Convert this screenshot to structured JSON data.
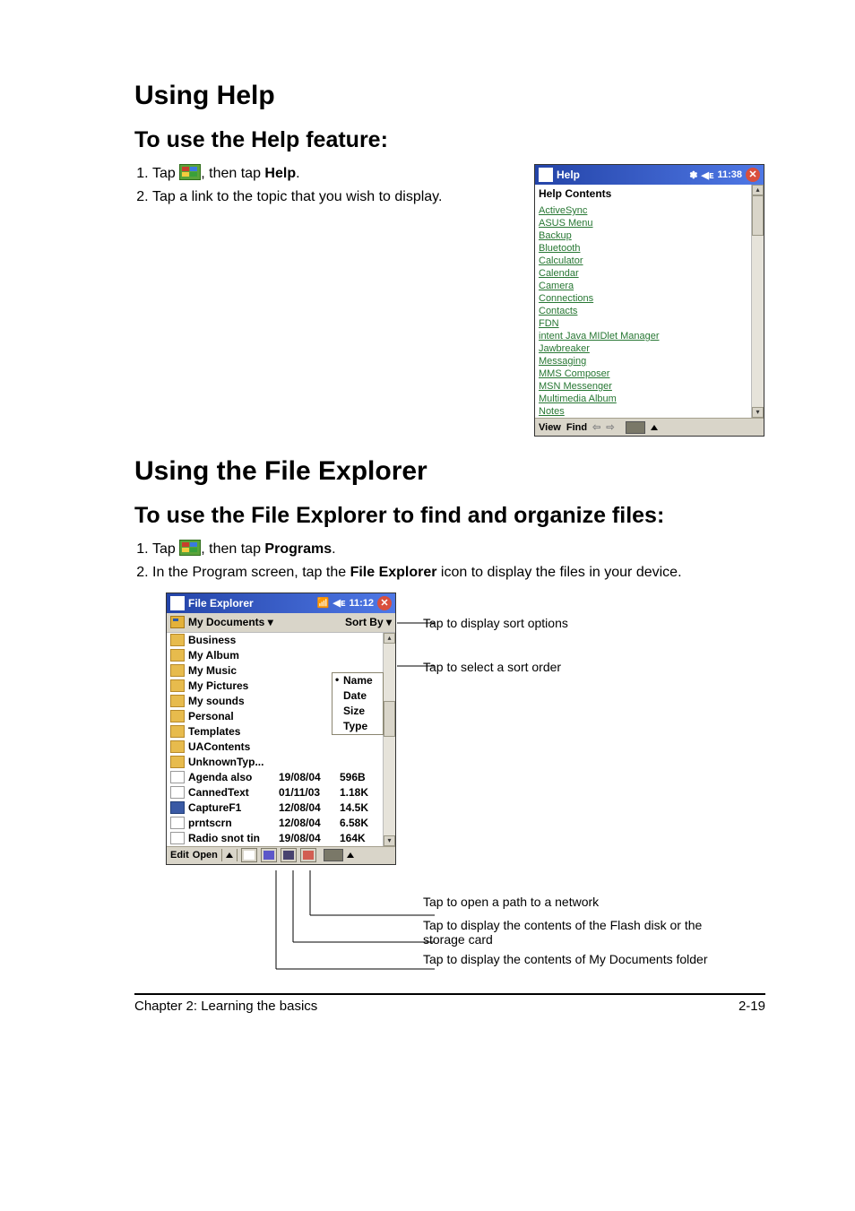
{
  "headings": {
    "using_help": "Using Help",
    "help_sub": "To use the Help feature:",
    "using_fe": "Using the File Explorer",
    "fe_sub": "To use the File Explorer to find and organize files:"
  },
  "help_steps": {
    "s1_pre": "Tap ",
    "s1_post": ", then tap ",
    "s1_bold": "Help",
    "s1_end": ".",
    "s2": "Tap a link to the topic that you wish to display."
  },
  "fe_steps": {
    "s1_pre": "Tap ",
    "s1_post": ", then tap ",
    "s1_bold": "Programs",
    "s1_end": ".",
    "s2_pre": "In the Program screen, tap the ",
    "s2_bold": "File Explorer",
    "s2_post": " icon to display the files in your device."
  },
  "help_device": {
    "title": "Help",
    "time": "11:38",
    "content_title": "Help Contents",
    "links": [
      "ActiveSync",
      "ASUS Menu",
      "Backup",
      "Bluetooth",
      "Calculator",
      "Calendar",
      "Camera",
      "Connections",
      "Contacts",
      "FDN",
      "intent Java MIDlet Manager",
      "Jawbreaker",
      "Messaging",
      "MMS Composer",
      "MSN Messenger",
      "Multimedia Album",
      "Notes"
    ],
    "bottom": {
      "view": "View",
      "find": "Find"
    }
  },
  "fe_device": {
    "title": "File Explorer",
    "time": "11:12",
    "dropdown": "My Documents",
    "sortby": "Sort By",
    "sort_options": [
      "Name",
      "Date",
      "Size",
      "Type"
    ],
    "rows": [
      {
        "icon": "folder",
        "name": "Business",
        "date": "",
        "size": ""
      },
      {
        "icon": "folder",
        "name": "My Album",
        "date": "",
        "size": ""
      },
      {
        "icon": "folder",
        "name": "My Music",
        "date": "",
        "size": ""
      },
      {
        "icon": "folder",
        "name": "My Pictures",
        "date": "",
        "size": ""
      },
      {
        "icon": "folder",
        "name": "My sounds",
        "date": "",
        "size": ""
      },
      {
        "icon": "folder",
        "name": "Personal",
        "date": "",
        "size": ""
      },
      {
        "icon": "folder",
        "name": "Templates",
        "date": "",
        "size": ""
      },
      {
        "icon": "folder",
        "name": "UAContents",
        "date": "",
        "size": ""
      },
      {
        "icon": "folder",
        "name": "UnknownTyp...",
        "date": "",
        "size": ""
      },
      {
        "icon": "file",
        "name": "Agenda also",
        "date": "19/08/04",
        "size": "596B"
      },
      {
        "icon": "file",
        "name": "CannedText",
        "date": "01/11/03",
        "size": "1.18K"
      },
      {
        "icon": "app",
        "name": "CaptureF1",
        "date": "12/08/04",
        "size": "14.5K"
      },
      {
        "icon": "bmp",
        "name": "prntscrn",
        "date": "12/08/04",
        "size": "6.58K"
      },
      {
        "icon": "file",
        "name": "Radio snot tin",
        "date": "19/08/04",
        "size": "164K"
      }
    ],
    "bottom": {
      "edit": "Edit",
      "open": "Open"
    }
  },
  "callouts": {
    "sortby": "Tap to display sort options",
    "sortorder": "Tap to select a sort order",
    "net": "Tap to open a path to a network",
    "flash": "Tap to display the contents of the Flash disk or the storage card",
    "mydocs": "Tap to display the contents of My Documents folder"
  },
  "footer": {
    "left": "Chapter 2: Learning the basics",
    "right": "2-19"
  }
}
